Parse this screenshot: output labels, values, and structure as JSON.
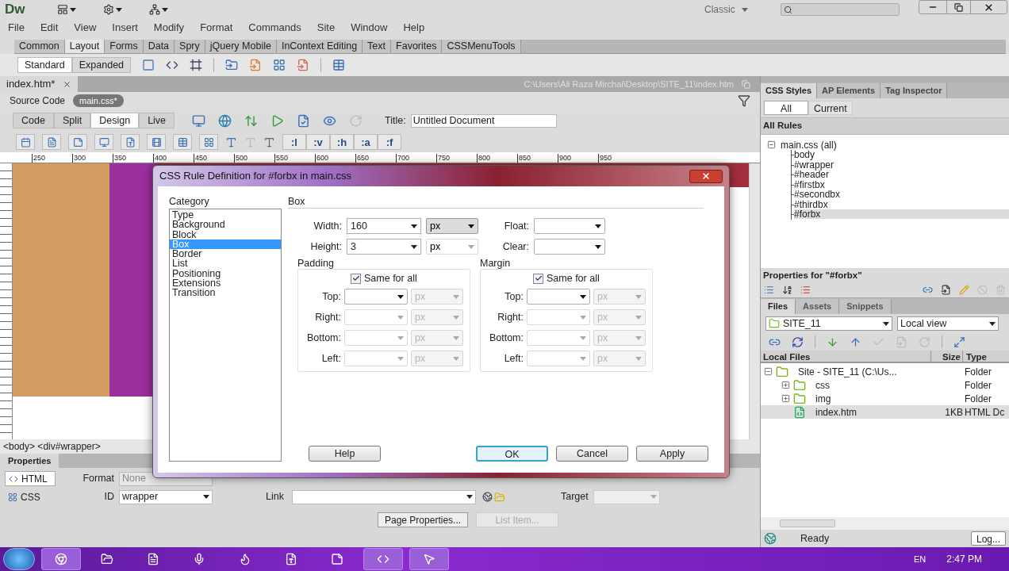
{
  "app": {
    "logo": "Dw",
    "workspace": "Classic"
  },
  "menu": [
    "File",
    "Edit",
    "View",
    "Insert",
    "Modify",
    "Format",
    "Commands",
    "Site",
    "Window",
    "Help"
  ],
  "insert_tabs": [
    {
      "label": "Common",
      "selected": false
    },
    {
      "label": "Layout",
      "selected": true
    },
    {
      "label": "Forms",
      "selected": false
    },
    {
      "label": "Data",
      "selected": false
    },
    {
      "label": "Spry",
      "selected": false
    },
    {
      "label": "jQuery Mobile",
      "selected": false
    },
    {
      "label": "InContext Editing",
      "selected": false
    },
    {
      "label": "Text",
      "selected": false
    },
    {
      "label": "Favorites",
      "selected": false
    },
    {
      "label": "CSSMenuTools",
      "selected": false
    }
  ],
  "layout_modes": [
    {
      "label": "Standard",
      "selected": true
    },
    {
      "label": "Expanded",
      "selected": false
    }
  ],
  "document": {
    "tab": "index.htm*",
    "path": "C:\\Users\\Ali Raza Mirchai\\Desktop\\SITE_11\\index.htm",
    "source_label": "Source Code",
    "related_file": "main.css*",
    "views": [
      {
        "label": "Code",
        "selected": false
      },
      {
        "label": "Split",
        "selected": false
      },
      {
        "label": "Design",
        "selected": true
      },
      {
        "label": "Live",
        "selected": false
      }
    ],
    "title_label": "Title:",
    "title_value": "Untitled Document",
    "css_buttons": [
      ":l",
      ":v",
      ":h",
      ":a",
      ":f"
    ],
    "ruler": [
      "250",
      "300",
      "350",
      "400",
      "450",
      "500",
      "550",
      "600",
      "650",
      "700",
      "750",
      "800",
      "850",
      "900",
      "950"
    ],
    "tag_selector": "<body> <div#wrapper>"
  },
  "properties": {
    "title": "Properties",
    "modes": [
      {
        "label": "HTML",
        "selected": true
      },
      {
        "label": "CSS",
        "selected": false
      }
    ],
    "format_label": "Format",
    "format": "None",
    "id_label": "ID",
    "id": "wrapper",
    "link_label": "Link",
    "target_label": "Target",
    "buttons": [
      {
        "label": "Page Properties...",
        "disabled": false
      },
      {
        "label": "List Item...",
        "disabled": true
      }
    ]
  },
  "css_panel": {
    "tabs": [
      {
        "label": "CSS Styles",
        "selected": true
      },
      {
        "label": "AP Elements",
        "selected": false
      },
      {
        "label": "Tag Inspector",
        "selected": false
      }
    ],
    "filters": [
      {
        "label": "All",
        "selected": true
      },
      {
        "label": "Current",
        "selected": false
      }
    ],
    "section": "All Rules",
    "tree": {
      "label": "main.css (all)",
      "expanded": true,
      "children": [
        {
          "label": "body",
          "selected": false
        },
        {
          "label": "#wrapper",
          "selected": false
        },
        {
          "label": "#header",
          "selected": false
        },
        {
          "label": "#firstbx",
          "selected": false
        },
        {
          "label": "#secondbx",
          "selected": false
        },
        {
          "label": "#thirdbx",
          "selected": false
        },
        {
          "label": "#forbx",
          "selected": true
        }
      ]
    },
    "properties_title": "Properties for \"#forbx\""
  },
  "files_panel": {
    "tabs": [
      {
        "label": "Files",
        "selected": true
      },
      {
        "label": "Assets",
        "selected": false
      },
      {
        "label": "Snippets",
        "selected": false
      }
    ],
    "site": "SITE_11",
    "view": "Local view",
    "columns": [
      "Local Files",
      "Size",
      "Type"
    ],
    "tree": [
      {
        "kind": "folder",
        "name": "Site - SITE_11 (C:\\Us...",
        "type": "Folder",
        "expanded": true,
        "selected": false,
        "children": [
          {
            "kind": "folder",
            "name": "css",
            "type": "Folder",
            "expanded": false,
            "selected": false
          },
          {
            "kind": "folder",
            "name": "img",
            "type": "Folder",
            "expanded": false,
            "selected": false
          },
          {
            "kind": "file",
            "name": "index.htm",
            "size": "1KB",
            "type": "HTML Dc",
            "selected": true
          }
        ]
      }
    ],
    "status": "Ready",
    "log_button": "Log..."
  },
  "dialog": {
    "title": "CSS Rule Definition for #forbx in main.css",
    "category_label": "Category",
    "categories": [
      {
        "label": "Type",
        "selected": false
      },
      {
        "label": "Background",
        "selected": false
      },
      {
        "label": "Block",
        "selected": false
      },
      {
        "label": "Box",
        "selected": true
      },
      {
        "label": "Border",
        "selected": false
      },
      {
        "label": "List",
        "selected": false
      },
      {
        "label": "Positioning",
        "selected": false
      },
      {
        "label": "Extensions",
        "selected": false
      },
      {
        "label": "Transition",
        "selected": false
      }
    ],
    "section": "Box",
    "size_rows": [
      {
        "label": "Width:",
        "value": "160",
        "unit": "px",
        "unit_disabled": false,
        "side_label": "Float:"
      },
      {
        "label": "Height:",
        "value": "3",
        "unit": "px",
        "unit_disabled": true,
        "side_label": "Clear:"
      }
    ],
    "groups": [
      {
        "label": "Padding",
        "same_for_all": true,
        "same_label": "Same for all",
        "sides": [
          {
            "label": "Top:",
            "unit": "px",
            "disabled": false
          },
          {
            "label": "Right:",
            "unit": "px",
            "disabled": true
          },
          {
            "label": "Bottom:",
            "unit": "px",
            "disabled": true
          },
          {
            "label": "Left:",
            "unit": "px",
            "disabled": true
          }
        ]
      },
      {
        "label": "Margin",
        "same_for_all": true,
        "same_label": "Same for all",
        "sides": [
          {
            "label": "Top:",
            "unit": "px",
            "disabled": false
          },
          {
            "label": "Right:",
            "unit": "px",
            "disabled": true
          },
          {
            "label": "Bottom:",
            "unit": "px",
            "disabled": true
          },
          {
            "label": "Left:",
            "unit": "px",
            "disabled": true
          }
        ]
      }
    ],
    "buttons": [
      {
        "label": "Help",
        "default": false
      },
      {
        "label": "OK",
        "default": true
      },
      {
        "label": "Cancel",
        "default": false
      },
      {
        "label": "Apply",
        "default": false
      }
    ]
  },
  "taskbar": {
    "language": "EN",
    "time": "2:47 PM"
  }
}
